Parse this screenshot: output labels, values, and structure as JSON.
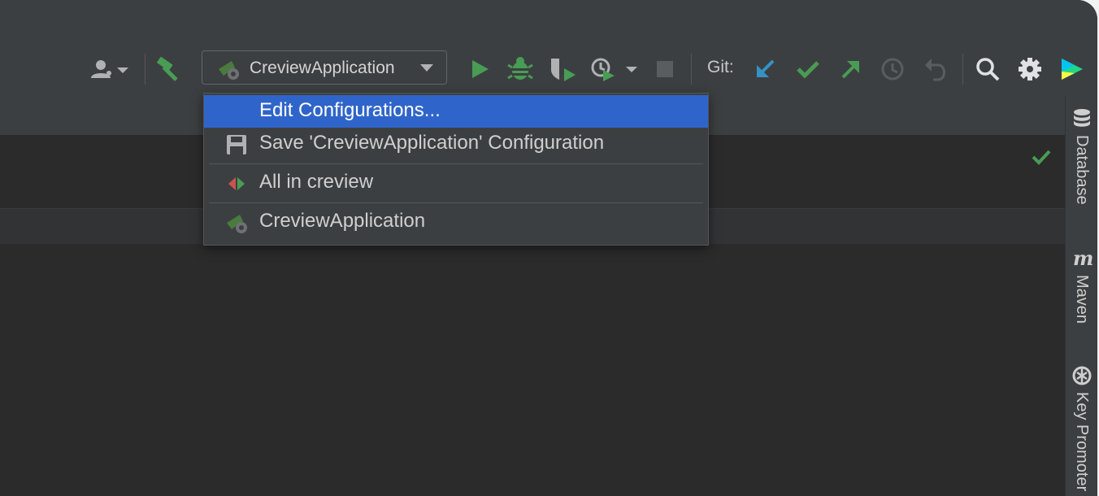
{
  "toolbar": {
    "run_config": {
      "label": "CreviewApplication"
    },
    "git_label": "Git:",
    "icons": [
      "user-icon",
      "chevron-down-icon",
      "hammer-icon",
      "spring-boot-icon",
      "run-icon",
      "debug-icon",
      "coverage-icon",
      "profile-icon",
      "stop-icon",
      "git-update-icon",
      "git-commit-icon",
      "git-push-icon",
      "history-icon",
      "rollback-icon",
      "search-icon",
      "gear-icon",
      "plugin-logo-icon"
    ]
  },
  "menu": {
    "items": [
      {
        "label": "Edit Configurations...",
        "selected": true
      },
      {
        "label": "Save 'CreviewApplication' Configuration",
        "icon": "save-icon"
      },
      {
        "label": "All in creview",
        "icon": "test-icon"
      },
      {
        "label": "CreviewApplication",
        "icon": "spring-boot-icon"
      }
    ]
  },
  "right_panel": {
    "tabs": [
      {
        "label": "Database",
        "icon": "database-icon"
      },
      {
        "label": "Maven",
        "icon": "maven-icon"
      },
      {
        "label": "Key Promoter",
        "icon": "key-promoter-icon"
      }
    ]
  },
  "colors": {
    "accent": "#2f65ca",
    "green": "#499c54",
    "blue": "#3592c4",
    "background": "#2b2b2b",
    "panel": "#3c3f41"
  }
}
